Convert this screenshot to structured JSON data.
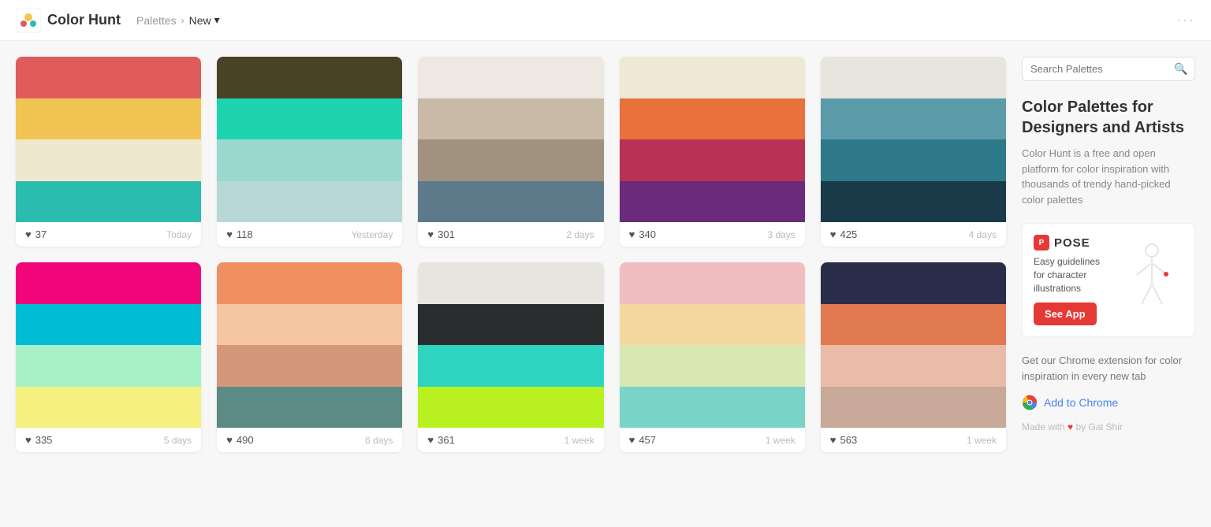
{
  "header": {
    "logo_text": "Color Hunt",
    "nav_palettes": "Palettes",
    "nav_separator": "›",
    "nav_new": "New",
    "nav_new_chevron": "▾",
    "dots": "···"
  },
  "sidebar": {
    "search_placeholder": "Search Palettes",
    "title": "Color Palettes for Designers and Artists",
    "description": "Color Hunt is a free and open platform for color inspiration with thousands of trendy hand-picked color palettes",
    "ad": {
      "brand_icon_text": "P",
      "brand_name": "POSE",
      "tagline": "Easy guidelines for character illustrations",
      "cta_label": "See App"
    },
    "chrome_ext_text": "Get our Chrome extension for color inspiration in every new tab",
    "add_to_chrome": "Add to Chrome",
    "made_with": "Made with",
    "made_by": "by Gal Shir"
  },
  "palettes": [
    {
      "id": 1,
      "likes": 37,
      "date": "Today",
      "colors": [
        "#E05C5C",
        "#F0C553",
        "#F0E8CE",
        "#2BBCB0"
      ]
    },
    {
      "id": 2,
      "likes": 118,
      "date": "Yesterday",
      "colors": [
        "#4A4227",
        "#1DD3B0",
        "#9BD8CF",
        "#B8D8D8"
      ],
      "hex_visible": "#1DD3B0",
      "hex_label_index": 1
    },
    {
      "id": 3,
      "likes": 301,
      "date": "2 days",
      "colors": [
        "#EDE8E1",
        "#C9B9A7",
        "#A0927F",
        "#5D7A8A"
      ],
      "hex_visible": "#C7B198",
      "hex_label_index": 1
    },
    {
      "id": 4,
      "likes": 340,
      "date": "3 days",
      "colors": [
        "#EEE8D5",
        "#E8713C",
        "#B83255",
        "#6B2B7A"
      ]
    },
    {
      "id": 5,
      "likes": 425,
      "date": "4 days",
      "colors": [
        "#E8E4DE",
        "#5C9BAA",
        "#2E7A8A",
        "#1A3A4A"
      ]
    },
    {
      "id": 6,
      "likes": 335,
      "date": "5 days",
      "colors": [
        "#F0057A",
        "#00BCD4",
        "#A8F0C8",
        "#F5F080"
      ]
    },
    {
      "id": 7,
      "likes": 490,
      "date": "6 days",
      "colors": [
        "#F09060",
        "#F5C4A0",
        "#D4977A",
        "#5C8A85"
      ]
    },
    {
      "id": 8,
      "likes": 361,
      "date": "1 week",
      "colors": [
        "#E8E4E0",
        "#2A2D2E",
        "#2DD4C0",
        "#B8F020"
      ]
    },
    {
      "id": 9,
      "likes": 457,
      "date": "1 week",
      "colors": [
        "#F0BEC0",
        "#F5D8A0",
        "#D8E8B0",
        "#7AD4C8"
      ]
    },
    {
      "id": 10,
      "likes": 563,
      "date": "1 week",
      "colors": [
        "#2A2D4A",
        "#E07850",
        "#E8BCA8",
        "#C8A898"
      ]
    }
  ]
}
